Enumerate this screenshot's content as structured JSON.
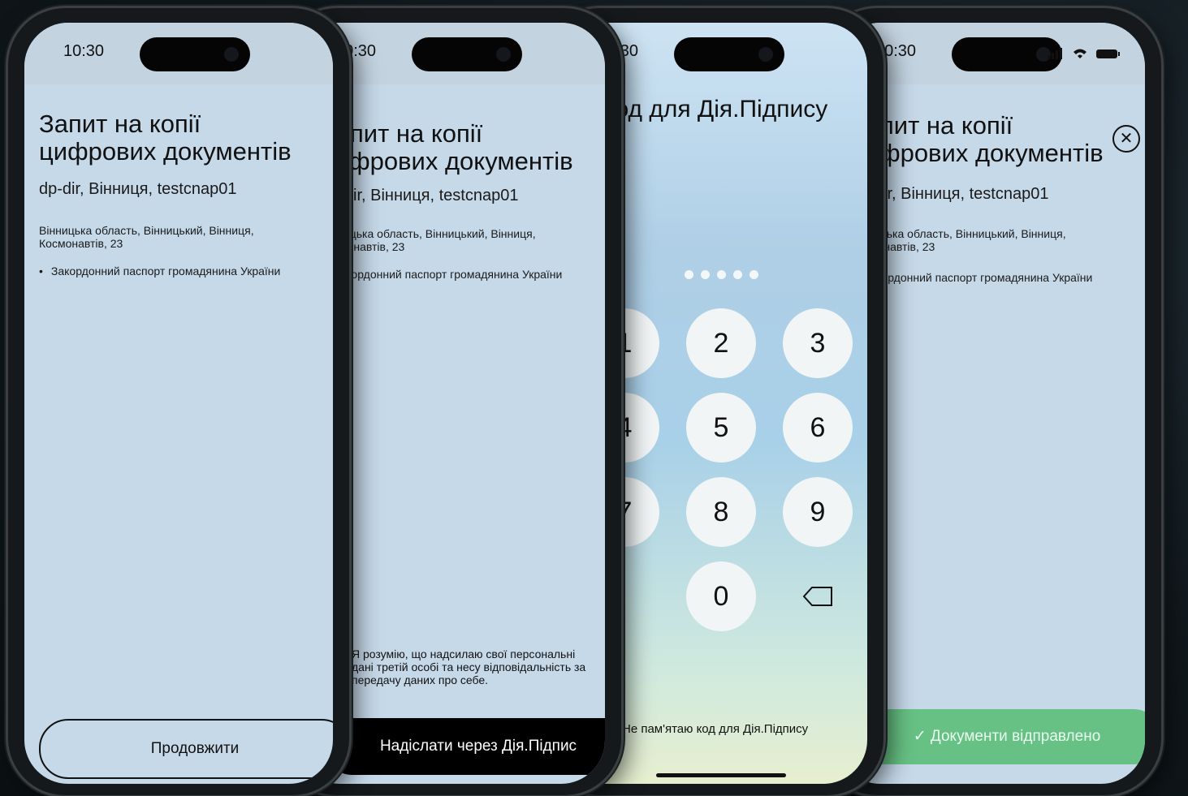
{
  "status": {
    "time": "10:30"
  },
  "request": {
    "title_line1": "Запит на копії",
    "title_line2": "цифрових документів",
    "org": "dp-dir, Вінниця, testcnap01",
    "address_line1": "Вінницька область, Вінницький, Вінниця,",
    "address_line2": "Космонавтів, 23",
    "document": "Закордонний паспорт громадянина України"
  },
  "screen1": {
    "continue_button": "Продовжити"
  },
  "screen2": {
    "consent": "Я розумію, що надсилаю свої персональні дані третій особі та несу відповідальність за передачу даних про себе.",
    "consent_checked": true,
    "send_button": "Надіслати через Дія.Підпис"
  },
  "screen3": {
    "title": "Код для Дія.Підпису",
    "pin_filled": 5,
    "pin_length": 5,
    "keys": [
      "1",
      "2",
      "3",
      "4",
      "5",
      "6",
      "7",
      "8",
      "9",
      "0"
    ],
    "forgot": "Не пам'ятаю код для Дія.Підпису"
  },
  "screen4": {
    "done_button": "✓ Документи відправлено",
    "accent": "#67c184"
  }
}
